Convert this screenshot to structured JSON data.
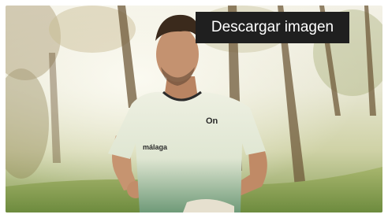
{
  "photo": {
    "alt": "",
    "shirt_logo_text": "málaga",
    "brand_mark": "On"
  },
  "actions": {
    "download_label": "Descargar imagen"
  }
}
